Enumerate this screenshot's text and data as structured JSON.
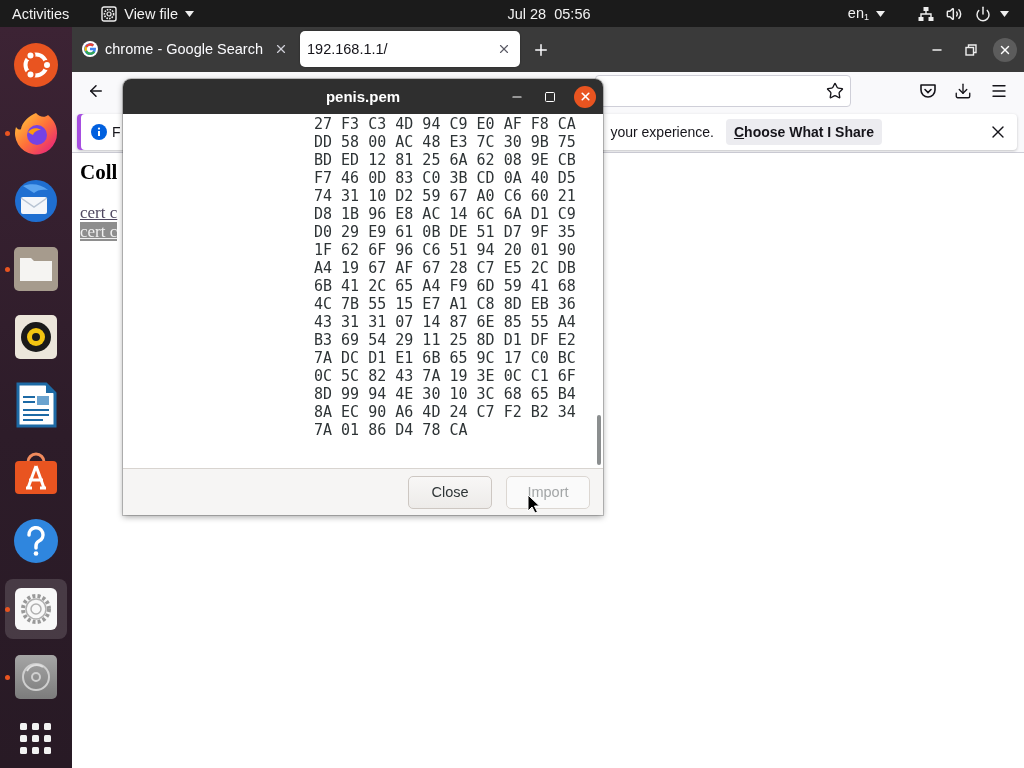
{
  "top_bar": {
    "activities": "Activities",
    "app_menu": "View file",
    "clock": "Jul 28  05:56",
    "input_source": "en$_{1}$"
  },
  "dock": {
    "items": [
      {
        "kind": "logo",
        "running": false,
        "selected": false
      },
      {
        "kind": "browser",
        "running": true,
        "selected": false
      },
      {
        "kind": "mail",
        "running": false,
        "selected": false
      },
      {
        "kind": "files",
        "running": true,
        "selected": false
      },
      {
        "kind": "music",
        "running": false,
        "selected": false
      },
      {
        "kind": "document",
        "running": false,
        "selected": false
      },
      {
        "kind": "store",
        "running": false,
        "selected": false
      },
      {
        "kind": "help",
        "running": false,
        "selected": false
      },
      {
        "kind": "settings",
        "running": true,
        "selected": true
      },
      {
        "kind": "disc",
        "running": true,
        "selected": false
      },
      {
        "kind": "apps",
        "running": false,
        "selected": false
      }
    ]
  },
  "browser": {
    "tabs": [
      {
        "title": "chrome - Google Search",
        "selected": false
      },
      {
        "title": "192.168.1.1/",
        "selected": true
      }
    ],
    "notification": {
      "text_start": "F",
      "text_end": "your experience.",
      "button": "Choose What I Share"
    },
    "page": {
      "heading": "Coll",
      "links": [
        {
          "text": "cert c",
          "selected": false
        },
        {
          "text": "cert c",
          "selected": true
        }
      ]
    }
  },
  "dialog": {
    "title": "penis.pem",
    "hex_lines": [
      "27 F3 C3 4D 94 C9 E0 AF F8 CA",
      "DD 58 00 AC 48 E3 7C 30 9B 75",
      "BD ED 12 81 25 6A 62 08 9E CB",
      "F7 46 0D 83 C0 3B CD 0A 40 D5",
      "74 31 10 D2 59 67 A0 C6 60 21",
      "D8 1B 96 E8 AC 14 6C 6A D1 C9",
      "D0 29 E9 61 0B DE 51 D7 9F 35",
      "1F 62 6F 96 C6 51 94 20 01 90",
      "A4 19 67 AF 67 28 C7 E5 2C DB",
      "6B 41 2C 65 A4 F9 6D 59 41 68",
      "4C 7B 55 15 E7 A1 C8 8D EB 36",
      "43 31 31 07 14 87 6E 85 55 A4",
      "B3 69 54 29 11 25 8D D1 DF E2",
      "7A DC D1 E1 6B 65 9C 17 C0 BC",
      "0C 5C 82 43 7A 19 3E 0C C1 6F",
      "8D 99 94 4E 30 10 3C 68 65 B4",
      "8A EC 90 A6 4D 24 C7 F2 B2 34",
      "7A 01 86 D4 78 CA"
    ],
    "buttons": [
      {
        "label": "Close",
        "disabled": false
      },
      {
        "label": "Import",
        "disabled": true
      }
    ]
  }
}
